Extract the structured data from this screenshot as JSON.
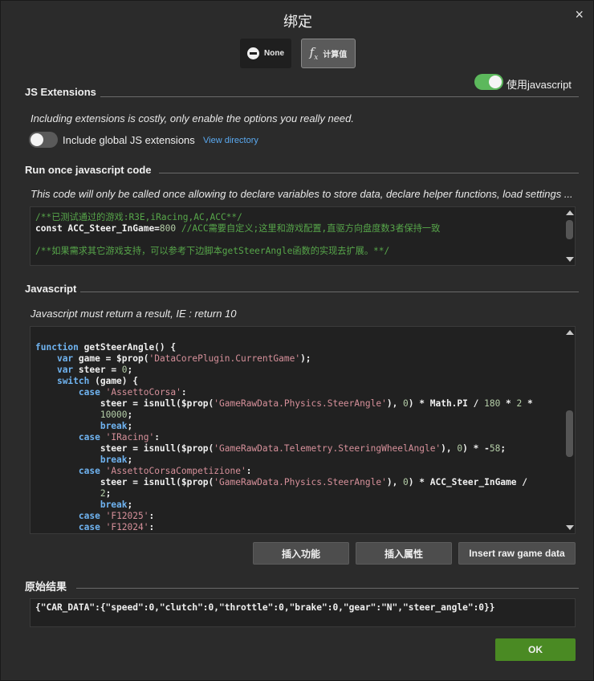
{
  "dialog": {
    "title": "绑定",
    "close_icon": "×"
  },
  "mode": {
    "none_label": "None",
    "calc_label": "计算值",
    "fx_glyph": "f",
    "fx_sub": "x"
  },
  "use_js": {
    "label": "使用javascript",
    "on": true
  },
  "extensions": {
    "heading": "JS Extensions",
    "note": "Including extensions is costly, only enable the options you really need.",
    "toggle_label": "Include global JS extensions",
    "link": "View directory"
  },
  "run_once": {
    "heading": "Run once javascript code",
    "note": "This code will only be called once allowing to declare variables to store data, declare helper functions, load settings ..."
  },
  "javascript": {
    "heading": "Javascript",
    "note": "Javascript must return a result, IE : return 10"
  },
  "buttons": {
    "insert_function": "插入功能",
    "insert_property": "插入属性",
    "insert_raw": "Insert raw game data"
  },
  "result": {
    "heading": "原始结果",
    "value": "{\"CAR_DATA\":{\"speed\":0,\"clutch\":0,\"throttle\":0,\"brake\":0,\"gear\":\"N\",\"steer_angle\":0}}"
  },
  "ok_label": "OK",
  "colors": {
    "accent_green": "#5cb85c",
    "ok_green": "#4a8a23",
    "link_blue": "#5aa9f0",
    "comment_green": "#57a64a",
    "string_pink": "#d6909a",
    "keyword_blue": "#6fb3f0"
  }
}
